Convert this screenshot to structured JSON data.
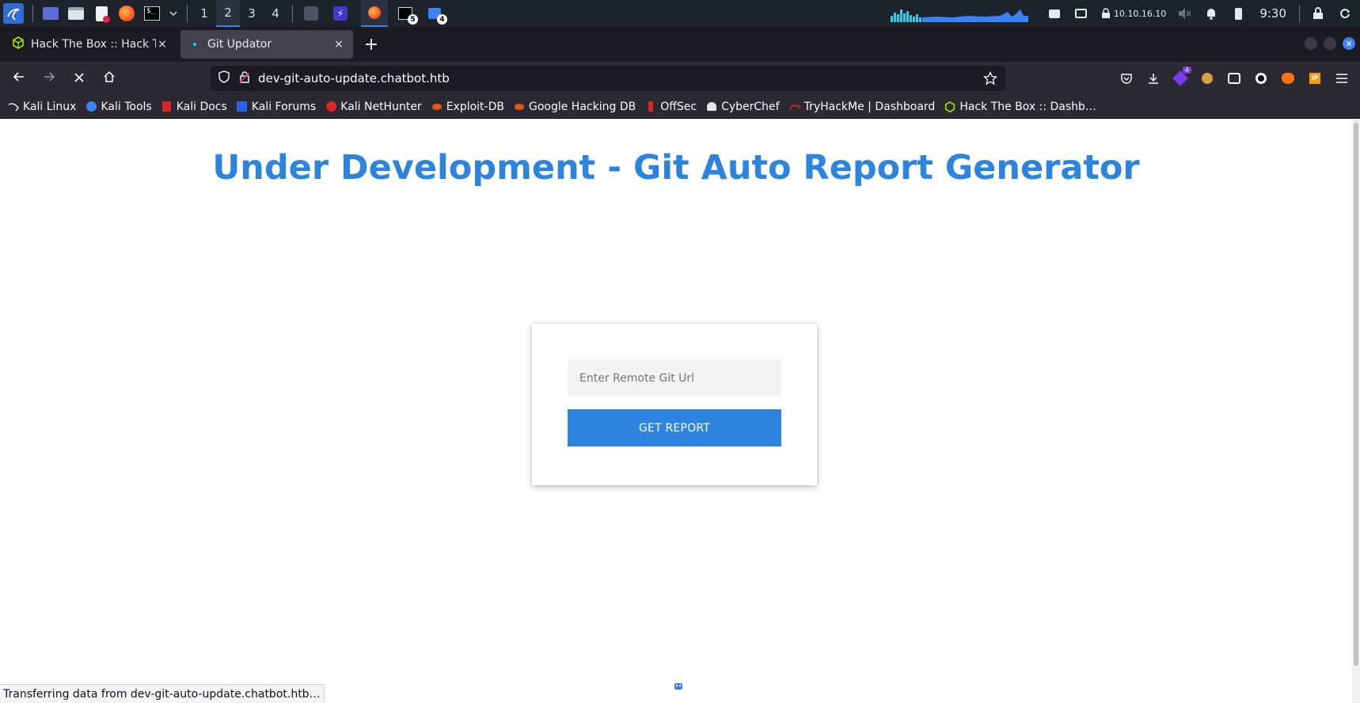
{
  "os_panel": {
    "workspaces": [
      "1",
      "2",
      "3",
      "4"
    ],
    "active_workspace": "2",
    "terminal_badge": "5",
    "files_badge": "4",
    "ip_address": "10.10.16.10",
    "clock": "9:30"
  },
  "tabs": [
    {
      "label": "Hack The Box :: Hack The Box",
      "active": false,
      "close": "×"
    },
    {
      "label": "Git Updator",
      "active": true,
      "close": "×"
    }
  ],
  "newtab_label": "+",
  "navbar": {
    "url": "dev-git-auto-update.chatbot.htb",
    "extension_badge": "4"
  },
  "bookmarks": [
    {
      "label": "Kali Linux",
      "icon": "kali-dragon-icon"
    },
    {
      "label": "Kali Tools",
      "icon": "kali-tools-icon"
    },
    {
      "label": "Kali Docs",
      "icon": "kali-docs-icon"
    },
    {
      "label": "Kali Forums",
      "icon": "kali-forums-icon"
    },
    {
      "label": "Kali NetHunter",
      "icon": "nethunter-icon"
    },
    {
      "label": "Exploit-DB",
      "icon": "exploit-db-icon"
    },
    {
      "label": "Google Hacking DB",
      "icon": "ghdb-icon"
    },
    {
      "label": "OffSec",
      "icon": "offsec-icon"
    },
    {
      "label": "CyberChef",
      "icon": "cyberchef-icon"
    },
    {
      "label": "TryHackMe | Dashboard",
      "icon": "tryhackme-icon"
    },
    {
      "label": "Hack The Box :: Dashb…",
      "icon": "htb-icon"
    }
  ],
  "page": {
    "title": "Under Development - Git Auto Report Generator",
    "input_placeholder": "Enter Remote Git Url",
    "button_label": "GET REPORT"
  },
  "status_bar": "Transferring data from dev-git-auto-update.chatbot.htb…",
  "colors": {
    "accent": "#2c84df",
    "os_panel_bg": "#1d222b",
    "browser_chrome": "#2b2a33"
  }
}
